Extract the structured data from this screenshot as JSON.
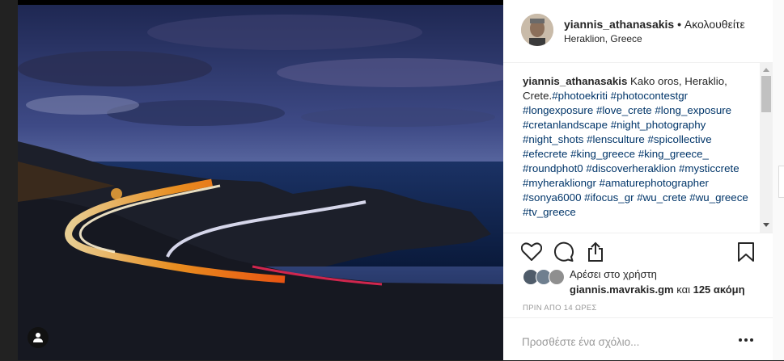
{
  "post": {
    "author": "yiannis_athanasakis",
    "separator": "•",
    "follow_status": "Ακολουθείτε",
    "location": "Heraklion, Greece",
    "caption_author": "yiannis_athanasakis",
    "caption_text": " Kako oros, Heraklio, Crete.",
    "hashtags": [
      "#photoekriti",
      "#photocontestgr",
      "#longexposure",
      "#love_crete",
      "#long_exposure",
      "#cretanlandscape",
      "#night_photography",
      "#night_shots",
      "#lensculture",
      "#spicollective",
      "#efecrete",
      "#king_greece",
      "#king_greece_",
      "#roundphot0",
      "#discoverheraklion",
      "#mysticcrete",
      "#myherakliongr",
      "#amaturephotographer",
      "#sonya6000",
      "#ifocus_gr",
      "#wu_crete",
      "#wu_greece",
      "#tv_greece"
    ],
    "liked_label": "Αρέσει στο χρήστη",
    "liked_by_user": "giannis.mavrakis.gm",
    "liked_by_rest": " και ",
    "liked_count": "125 ακόμη",
    "timestamp": "ΠΡΙΝ ΑΠΟ 14 ΩΡΕΣ",
    "comment_placeholder": "Προσθέστε ένα σχόλιο..."
  },
  "icons": [
    "user-tag-icon",
    "heart-icon",
    "comment-icon",
    "share-icon",
    "bookmark-icon",
    "more-options-icon"
  ],
  "colors": {
    "link": "#003569",
    "text": "#262626",
    "muted": "#999999",
    "border": "#efefef"
  }
}
